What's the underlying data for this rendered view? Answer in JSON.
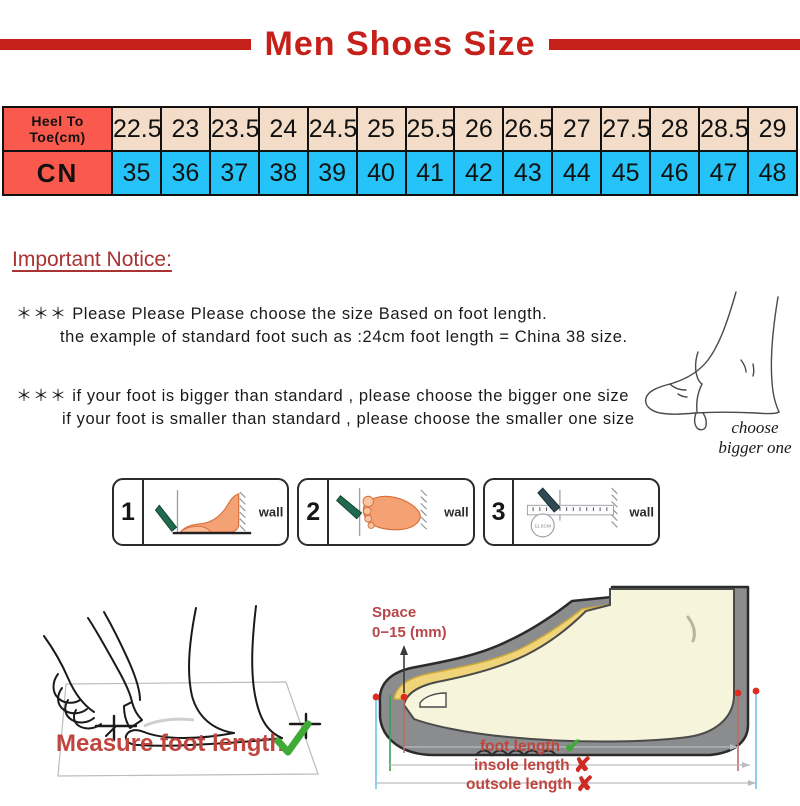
{
  "title": {
    "text": "Men  Shoes  Size",
    "accent_color": "#c5201a"
  },
  "size_table": {
    "row_headers": {
      "cm": "Heel To Toe(cm)",
      "cn": "CN"
    },
    "colors": {
      "header_bg": "#fa5a4d",
      "cm_bg": "#f3ddc9",
      "cn_bg": "#25c3f7"
    },
    "heel_to_toe_cm": [
      "22.5",
      "23",
      "23.5",
      "24",
      "24.5",
      "25",
      "25.5",
      "26",
      "26.5",
      "27",
      "27.5",
      "28",
      "28.5",
      "29"
    ],
    "cn_sizes": [
      "35",
      "36",
      "37",
      "38",
      "39",
      "40",
      "41",
      "42",
      "43",
      "44",
      "45",
      "46",
      "47",
      "48"
    ]
  },
  "notice": {
    "heading": "Important Notice:",
    "stars": "＊＊＊",
    "line1": "Please  Please  Please  choose  the  size  Based  on  foot  length.",
    "line2": "the  example  of  standard  foot  such  as  :24cm  foot  length  =  China 38 size.",
    "line3": "if your  foot  is  bigger  than  standard  ,  please  choose  the  bigger  one  size",
    "line4": "if your  foot  is  smaller  than  standard  ,  please  choose  the  smaller  one  size",
    "figure_caption_line1": "choose",
    "figure_caption_line2": "bigger one"
  },
  "steps": [
    {
      "number": "1",
      "wall_label": "wall"
    },
    {
      "number": "2",
      "wall_label": "wall"
    },
    {
      "number": "3",
      "wall_label": "wall",
      "ruler_badge": "11.5CM"
    }
  ],
  "measure_panel": {
    "caption": "Measure foot length",
    "check_mark": "✔"
  },
  "shoe_panel": {
    "space_label_line1": "Space",
    "space_label_line2": "0−15 (mm)",
    "labels": [
      {
        "text": "foot  length",
        "mark": "✔",
        "mark_type": "ok"
      },
      {
        "text": "insole length",
        "mark": "✘",
        "mark_type": "no"
      },
      {
        "text": "outsole length",
        "mark": "✘",
        "mark_type": "no"
      }
    ]
  }
}
